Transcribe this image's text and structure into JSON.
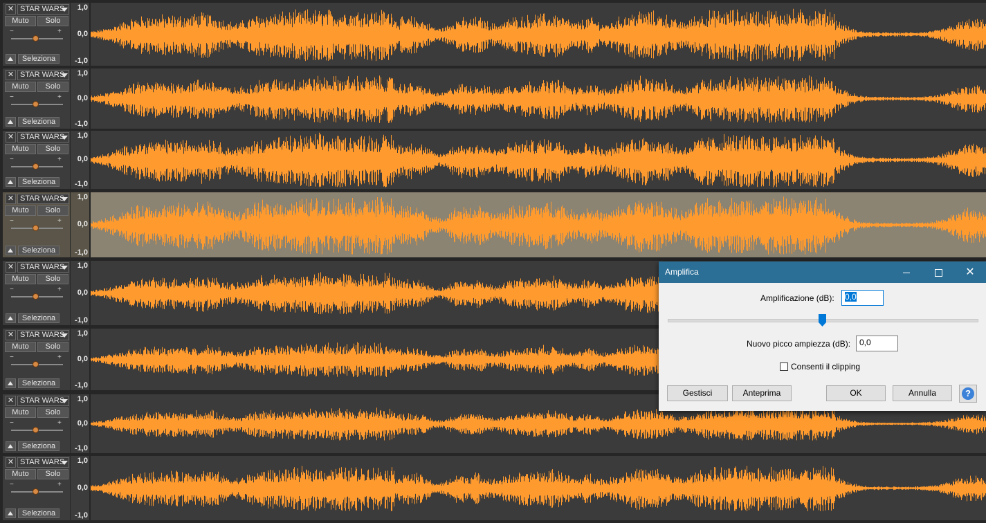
{
  "tracks": [
    {
      "name": "STAR WARS",
      "mute": "Muto",
      "solo": "Solo",
      "select": "Seleziona",
      "selected": false,
      "wave_color": "#ff9a2e",
      "amplitude": 0.9
    },
    {
      "name": "STAR WARS",
      "mute": "Muto",
      "solo": "Solo",
      "select": "Seleziona",
      "selected": false,
      "wave_color": "#ff9a2e",
      "amplitude": 0.85
    },
    {
      "name": "STAR WARS",
      "mute": "Muto",
      "solo": "Solo",
      "select": "Seleziona",
      "selected": false,
      "wave_color": "#ff9a2e",
      "amplitude": 1.0
    },
    {
      "name": "STAR WARS",
      "mute": "Muto",
      "solo": "Solo",
      "select": "Seleziona",
      "selected": true,
      "wave_color": "#ff9a2e",
      "amplitude": 0.95
    },
    {
      "name": "STAR WARS",
      "mute": "Muto",
      "solo": "Solo",
      "select": "Seleziona",
      "selected": false,
      "wave_color": "#ff9a2e",
      "amplitude": 0.7
    },
    {
      "name": "STAR WARS",
      "mute": "Muto",
      "solo": "Solo",
      "select": "Seleziona",
      "selected": false,
      "wave_color": "#ff9a2e",
      "amplitude": 0.6
    },
    {
      "name": "STAR WARS",
      "mute": "Muto",
      "solo": "Solo",
      "select": "Seleziona",
      "selected": false,
      "wave_color": "#ff9a2e",
      "amplitude": 0.6
    },
    {
      "name": "STAR WARS",
      "mute": "Muto",
      "solo": "Solo",
      "select": "Seleziona",
      "selected": false,
      "wave_color": "#ff9a2e",
      "amplitude": 0.75
    }
  ],
  "ruler": {
    "top": "1,0",
    "mid": "0,0",
    "bottom": "-1,0"
  },
  "dialog": {
    "title": "Amplifica",
    "amplification_label": "Amplificazione (dB):",
    "amplification_value": "0,0",
    "peak_label": "Nuovo picco ampiezza (dB):",
    "peak_value": "0,0",
    "clipping_label": "Consenti il clipping",
    "clipping_checked": false,
    "buttons": {
      "manage": "Gestisci",
      "preview": "Anteprima",
      "ok": "OK",
      "cancel": "Annulla"
    },
    "help_symbol": "?",
    "close_symbol": "✕"
  }
}
